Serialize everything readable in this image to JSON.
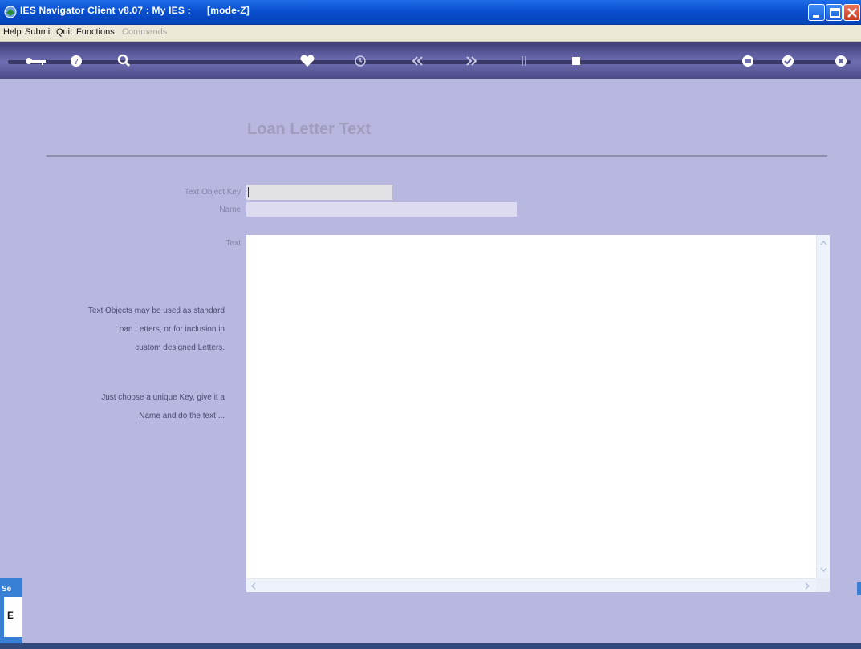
{
  "window": {
    "title": "IES Navigator Client v8.07 : My IES :",
    "mode": "[mode-Z]",
    "controls": {
      "minimize_icon": "minimize-icon",
      "maximize_icon": "maximize-icon",
      "close_icon": "close-icon"
    }
  },
  "menu": {
    "items": [
      {
        "label": "Help",
        "enabled": true
      },
      {
        "label": "Submit",
        "enabled": true
      },
      {
        "label": "Quit",
        "enabled": true
      },
      {
        "label": "Functions",
        "enabled": true
      },
      {
        "label": "Commands",
        "enabled": false
      }
    ]
  },
  "toolbar": {
    "icons": [
      "key-icon",
      "help-icon",
      "search-icon",
      "heart-icon",
      "clock-icon",
      "previous-icon",
      "next-icon",
      "insert-icon",
      "stop-icon",
      "print-icon",
      "confirm-icon",
      "cancel-icon"
    ]
  },
  "form": {
    "heading": "Loan Letter Text",
    "key_label": "Text Object Key",
    "key_value": "",
    "name_label": "Name",
    "name_value": "",
    "text_label": "Text",
    "text_value": ""
  },
  "help": {
    "para1": [
      "Text Objects may be used as standard",
      "Loan Letters, or for inclusion in",
      "custom designed Letters."
    ],
    "para2": [
      "Just choose a unique Key, give it a",
      "Name and do the text ..."
    ]
  },
  "side_panel": {
    "label": "Se",
    "letter": "E"
  },
  "colors": {
    "background": "#b8b7e0",
    "titlebar": "#0a4fcf",
    "toolbar": "#5e5da0",
    "heading": "#9e9dbd"
  }
}
